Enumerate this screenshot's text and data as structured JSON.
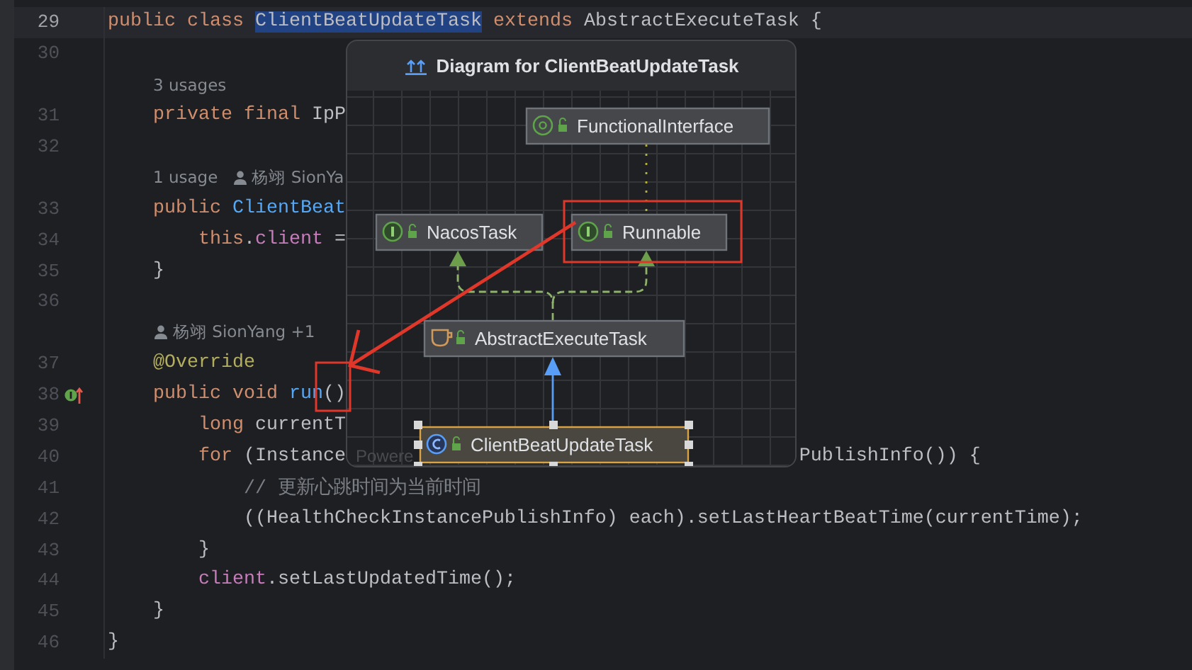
{
  "editor": {
    "rows": [
      {
        "kind": "code",
        "number": "29",
        "current": true,
        "implements_marker": false,
        "tokens": [
          {
            "text": "public ",
            "kind": "keyword"
          },
          {
            "text": "class ",
            "kind": "keyword"
          },
          {
            "text": "ClientBeatUpdateTask",
            "kind": "highlight"
          },
          {
            "text": " extends ",
            "kind": "keyword"
          },
          {
            "text": "AbstractExecuteTask {",
            "kind": "plain"
          }
        ]
      },
      {
        "kind": "code",
        "number": "30",
        "current": false,
        "implements_marker": false
      },
      {
        "kind": "hint",
        "parts": [
          {
            "kind": "usages",
            "text": "3 usages"
          }
        ]
      },
      {
        "kind": "code",
        "number": "31",
        "current": false,
        "implements_marker": false,
        "tokens": [
          {
            "text": "    private final ",
            "kind": "keyword"
          },
          {
            "text": "IpP",
            "kind": "plain"
          }
        ]
      },
      {
        "kind": "code",
        "number": "32",
        "current": false,
        "implements_marker": false
      },
      {
        "kind": "hint",
        "parts": [
          {
            "kind": "usages",
            "text": "1 usage"
          },
          {
            "kind": "author",
            "text": "杨翊 SionYa"
          }
        ]
      },
      {
        "kind": "code",
        "number": "33",
        "current": false,
        "implements_marker": false,
        "tokens": [
          {
            "text": "    public ",
            "kind": "keyword"
          },
          {
            "text": "ClientBeat",
            "kind": "method"
          }
        ]
      },
      {
        "kind": "code",
        "number": "34",
        "current": false,
        "implements_marker": false,
        "tokens": [
          {
            "text": "        this",
            "kind": "keyword"
          },
          {
            "text": ".",
            "kind": "plain"
          },
          {
            "text": "client",
            "kind": "field"
          },
          {
            "text": " =",
            "kind": "plain"
          }
        ]
      },
      {
        "kind": "code",
        "number": "35",
        "current": false,
        "implements_marker": false,
        "tokens": [
          {
            "text": "    }",
            "kind": "plain"
          }
        ]
      },
      {
        "kind": "code",
        "number": "36",
        "current": false,
        "implements_marker": false
      },
      {
        "kind": "hint",
        "parts": [
          {
            "kind": "author",
            "text": "杨翊 SionYang +1"
          }
        ]
      },
      {
        "kind": "code",
        "number": "37",
        "current": false,
        "implements_marker": false,
        "tokens": [
          {
            "text": "    @Override",
            "kind": "annotation"
          }
        ]
      },
      {
        "kind": "code",
        "number": "38",
        "current": false,
        "implements_marker": true,
        "tokens": [
          {
            "text": "    public void ",
            "kind": "keyword"
          },
          {
            "text": "run",
            "kind": "method"
          },
          {
            "text": "()",
            "kind": "plain"
          }
        ]
      },
      {
        "kind": "code",
        "number": "39",
        "current": false,
        "implements_marker": false,
        "tokens": [
          {
            "text": "        long ",
            "kind": "keyword"
          },
          {
            "text": "currentT",
            "kind": "plain"
          }
        ]
      },
      {
        "kind": "code",
        "number": "40",
        "current": false,
        "implements_marker": false,
        "tokens": [
          {
            "text": "        for ",
            "kind": "keyword"
          },
          {
            "text": "(Instance",
            "kind": "plain"
          }
        ],
        "tokens_after_popup": [
          {
            "text": "PublishInfo()) {",
            "kind": "plain"
          }
        ]
      },
      {
        "kind": "code",
        "number": "41",
        "current": false,
        "implements_marker": false,
        "tokens": [
          {
            "text": "            // 更新心跳时间为当前时间",
            "kind": "comment"
          }
        ]
      },
      {
        "kind": "code",
        "number": "42",
        "current": false,
        "implements_marker": false,
        "tokens": [
          {
            "text": "            ((HealthCheckInstancePublishInfo) each).setLastHeartBeatTime(currentTime);",
            "kind": "plain"
          }
        ]
      },
      {
        "kind": "code",
        "number": "43",
        "current": false,
        "implements_marker": false,
        "tokens": [
          {
            "text": "        }",
            "kind": "plain"
          }
        ]
      },
      {
        "kind": "code",
        "number": "44",
        "current": false,
        "implements_marker": false,
        "tokens": [
          {
            "text": "        client",
            "kind": "field"
          },
          {
            "text": ".setLastUpdatedTime();",
            "kind": "plain"
          }
        ]
      },
      {
        "kind": "code",
        "number": "45",
        "current": false,
        "implements_marker": false,
        "tokens": [
          {
            "text": "    }",
            "kind": "plain"
          }
        ]
      },
      {
        "kind": "code",
        "number": "46",
        "current": false,
        "implements_marker": false,
        "tokens": [
          {
            "text": "}",
            "kind": "plain"
          }
        ]
      }
    ]
  },
  "diagram_popup": {
    "title": "Diagram for ClientBeatUpdateTask",
    "nodes": [
      {
        "name": "FunctionalInterface",
        "kind": "annotation",
        "selected": false
      },
      {
        "name": "NacosTask",
        "kind": "interface",
        "selected": false
      },
      {
        "name": "Runnable",
        "kind": "interface",
        "selected": false
      },
      {
        "name": "AbstractExecuteTask",
        "kind": "abstract",
        "selected": false
      },
      {
        "name": "ClientBeatUpdateTask",
        "kind": "class",
        "selected": true
      }
    ],
    "edges": [
      {
        "kind": "annotation"
      },
      {
        "kind": "implements"
      },
      {
        "kind": "implements"
      },
      {
        "kind": "extends"
      }
    ],
    "footer": "Powere"
  },
  "annotations": [
    {
      "kind": "box",
      "color": "#e0372b"
    },
    {
      "kind": "box",
      "color": "#e0372b"
    },
    {
      "kind": "arrow",
      "color": "#e0372b"
    }
  ]
}
